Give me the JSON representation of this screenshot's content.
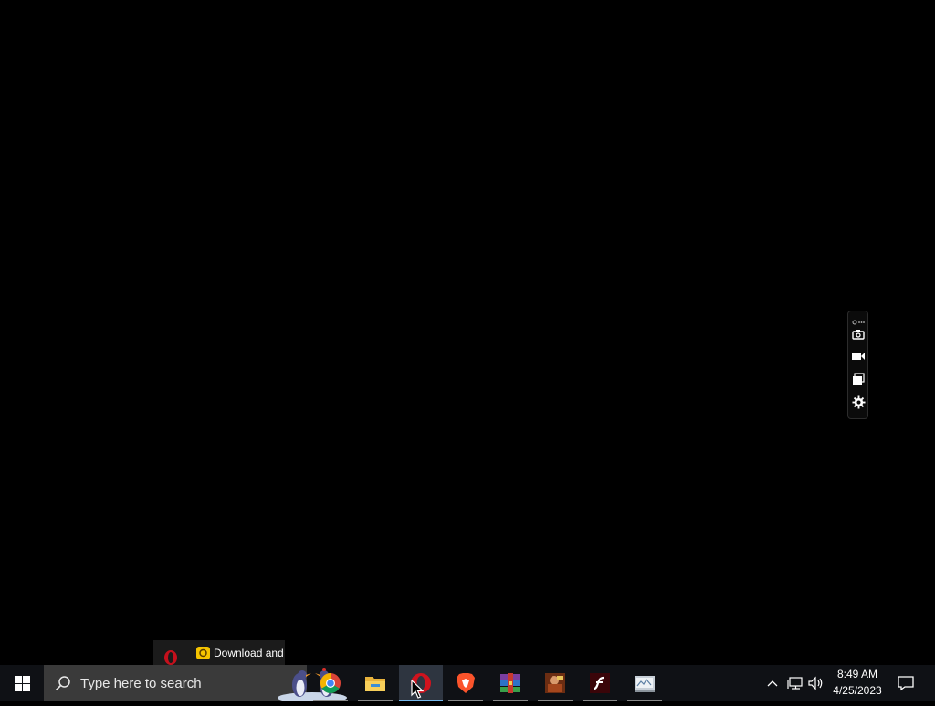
{
  "taskbar": {
    "search_placeholder": "Type here to search",
    "apps": [
      {
        "name": "Google Chrome",
        "icon": "chrome-icon",
        "running": true,
        "active": false
      },
      {
        "name": "File Explorer",
        "icon": "folder-icon",
        "running": true,
        "active": false
      },
      {
        "name": "Opera",
        "icon": "opera-icon",
        "running": true,
        "active": true
      },
      {
        "name": "Brave",
        "icon": "brave-icon",
        "running": true,
        "active": false
      },
      {
        "name": "WinRAR",
        "icon": "winrar-icon",
        "running": true,
        "active": false
      },
      {
        "name": "Game",
        "icon": "game-icon",
        "running": true,
        "active": false
      },
      {
        "name": "Adobe Flash",
        "icon": "flash-icon",
        "running": true,
        "active": false
      },
      {
        "name": "App",
        "icon": "app-icon",
        "running": true,
        "active": false
      }
    ],
    "clock": {
      "time": "8:49 AM",
      "date": "4/25/2023"
    }
  },
  "preview": {
    "text": "Download and"
  },
  "capture_toolbar": {
    "buttons": [
      "camera-icon",
      "video-icon",
      "window-icon",
      "settings-icon"
    ]
  },
  "colors": {
    "taskbar_bg": "#0f1115",
    "search_bg": "#3a3a3a",
    "active_accent": "#76b9ed",
    "desktop_bg": "#000000"
  }
}
